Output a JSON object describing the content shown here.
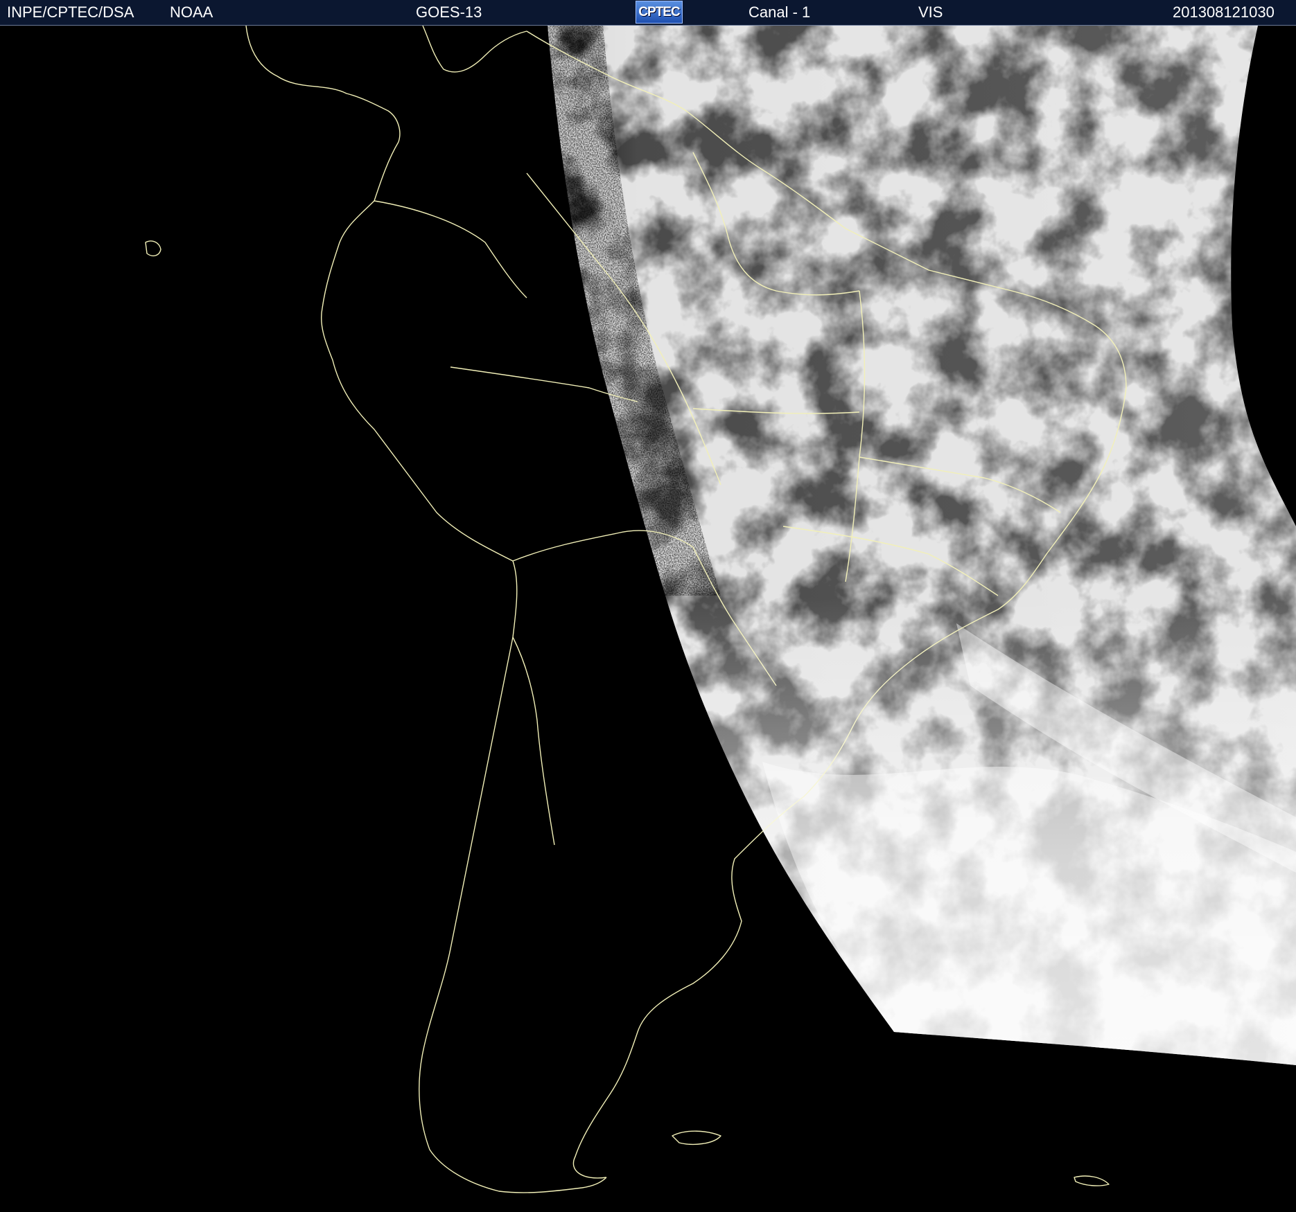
{
  "header": {
    "org": "INPE/CPTEC/DSA",
    "agency": "NOAA",
    "satellite": "GOES-13",
    "logo_text": "CPTEC",
    "channel": "Canal - 1",
    "band": "VIS",
    "timestamp": "201308121030"
  },
  "colors": {
    "header_bg": "#0b1730",
    "map_bg": "#000000",
    "coastline": "#f2f0b8",
    "cloud_white": "#f4f4f4",
    "surface_gray": "#5a5a5a"
  },
  "map": {
    "type": "satellite visible channel image",
    "region": "South America"
  }
}
